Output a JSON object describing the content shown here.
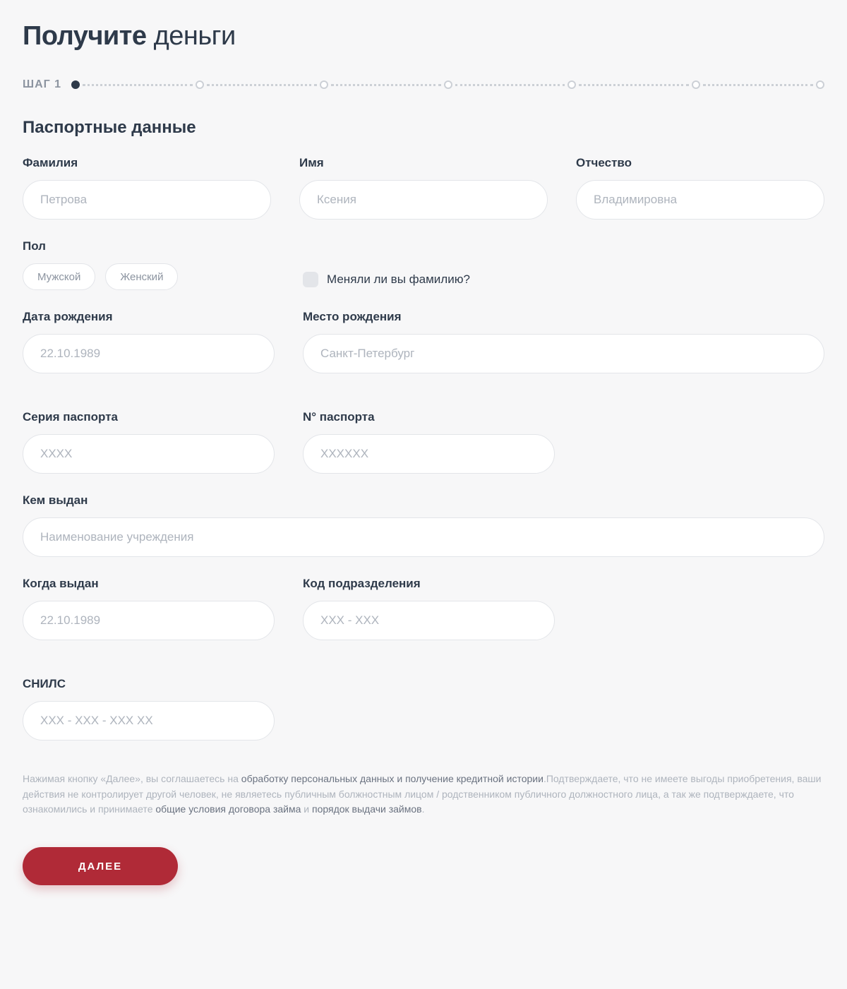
{
  "title": {
    "bold": "Получите",
    "rest": " деньги"
  },
  "step_label": "ШАГ 1",
  "section_head": "Паспортные данные",
  "fields": {
    "surname": {
      "label": "Фамилия",
      "placeholder": "Петрова"
    },
    "name": {
      "label": "Имя",
      "placeholder": "Ксения"
    },
    "patronymic": {
      "label": "Отчество",
      "placeholder": "Владимировна"
    },
    "gender": {
      "label": "Пол",
      "male": "Мужской",
      "female": "Женский"
    },
    "name_changed": "Меняли ли вы фамилию?",
    "dob": {
      "label": "Дата рождения",
      "placeholder": "22.10.1989"
    },
    "birthplace": {
      "label": "Место рождения",
      "placeholder": "Санкт-Петербург"
    },
    "passport_series": {
      "label": "Серия паспорта",
      "placeholder": "XXXX"
    },
    "passport_num": {
      "label": "N° паспорта",
      "placeholder": "XXXXXX"
    },
    "issued_by": {
      "label": "Кем выдан",
      "placeholder": "Наименование учреждения"
    },
    "issue_date": {
      "label": "Когда выдан",
      "placeholder": "22.10.1989"
    },
    "dept_code": {
      "label": "Код подразделения",
      "placeholder": "XXX - XXX"
    },
    "snils": {
      "label": "СНИЛС",
      "placeholder": "XXX - XXX - XXX XX"
    }
  },
  "disclaimer": {
    "t1": "Нажимая кнопку «Далее», вы соглашаетесь на ",
    "link1": "обработку персональных данных и получение кредитной истории",
    "t2": ".Подтверждаете, что не имеете выгоды приобретения, ваши действия не контролирует другой человек, не являетесь публичным болжностным лицом / родственником публичного должностного лица, а так же подтверждаете, что ознакомились и принимаете ",
    "link2": "общие условия договора займа",
    "t3": " и ",
    "link3": "порядок выдачи займов",
    "t4": "."
  },
  "submit": "ДАЛЕЕ"
}
